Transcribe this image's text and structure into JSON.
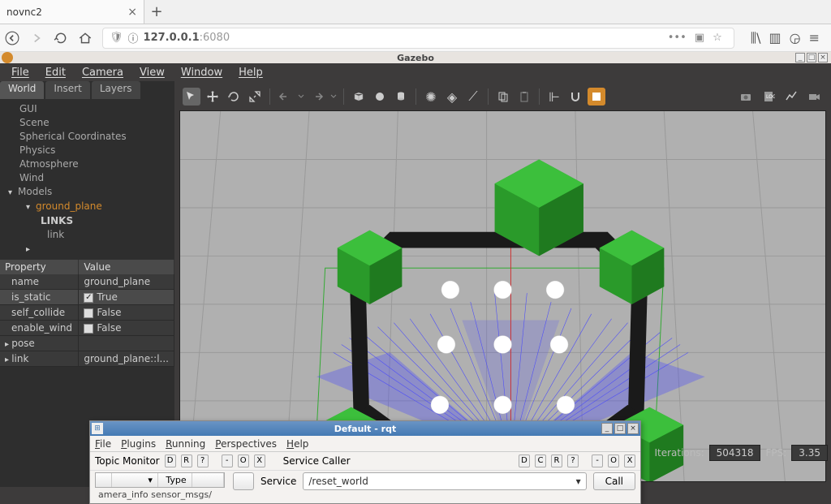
{
  "browser": {
    "tab_title": "novnc2",
    "url_host": "127.0.0.1",
    "url_port": ":6080"
  },
  "gazebo": {
    "title": "Gazebo",
    "menu": {
      "file": "File",
      "edit": "Edit",
      "camera": "Camera",
      "view": "View",
      "window": "Window",
      "help": "Help"
    },
    "left_tabs": {
      "world": "World",
      "insert": "Insert",
      "layers": "Layers"
    },
    "tree": {
      "gui": "GUI",
      "scene": "Scene",
      "spherical": "Spherical Coordinates",
      "physics": "Physics",
      "atmosphere": "Atmosphere",
      "wind": "Wind",
      "models": "Models",
      "ground_plane": "ground_plane",
      "links_header": "LINKS",
      "link": "link"
    },
    "prop_headers": {
      "property": "Property",
      "value": "Value"
    },
    "props": {
      "name_k": "name",
      "name_v": "ground_plane",
      "is_static_k": "is_static",
      "is_static_v": "True",
      "self_collide_k": "self_collide",
      "self_collide_v": "False",
      "enable_wind_k": "enable_wind",
      "enable_wind_v": "False",
      "pose_k": "pose",
      "link_k": "link",
      "link_v": "ground_plane::l..."
    },
    "status": {
      "iterations_label": "Iterations:",
      "iterations_value": "504318",
      "fps_label": "FPS:",
      "fps_value": "3.35"
    }
  },
  "rqt": {
    "title": "Default - rqt",
    "menu": {
      "file": "File",
      "plugins": "Plugins",
      "running": "Running",
      "perspectives": "Perspectives",
      "help": "Help"
    },
    "tm_label": "Topic Monitor",
    "sc_label": "Service Caller",
    "mini": {
      "d": "D",
      "r": "R",
      "q": "?",
      "dash": "-",
      "o": "O",
      "x": "X",
      "c": "C"
    },
    "type_hdr": "Type",
    "row1": "amera_info sensor_msgs/",
    "service_label": "Service",
    "service_value": "/reset_world",
    "call_label": "Call",
    "dropdown_caret": "▾"
  }
}
